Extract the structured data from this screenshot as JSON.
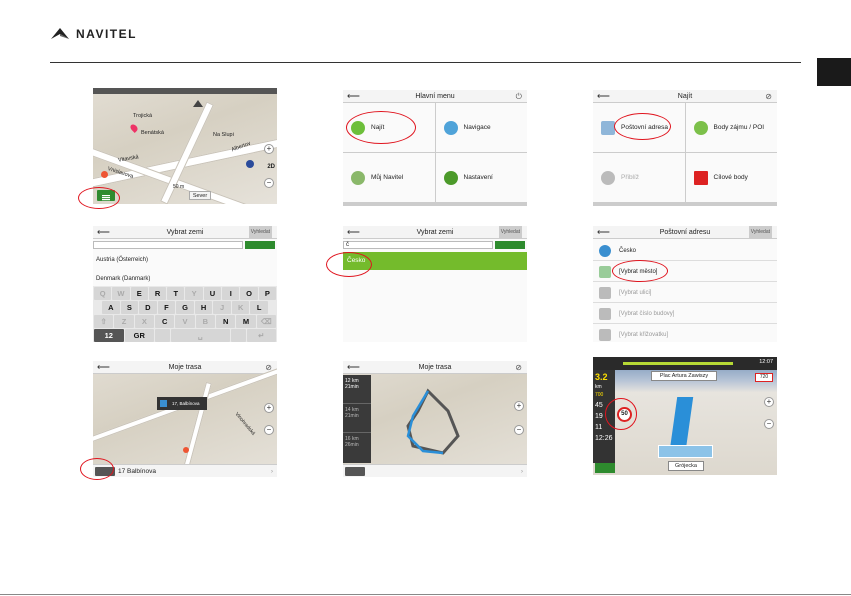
{
  "brand": {
    "name": "NAVITEL"
  },
  "screens": {
    "s1": {
      "street_names": [
        "Trojická",
        "Benátská",
        "Vltavská",
        "Albertov",
        "Na Slupi",
        "Vnislavova"
      ],
      "distance": "50 m",
      "direction": "Sever",
      "mode": "2D"
    },
    "s2": {
      "title": "Hlavní menu",
      "items": [
        "Najít",
        "Navigace",
        "Můj Navitel",
        "Nastavení"
      ]
    },
    "s3": {
      "title": "Najít",
      "items": [
        "Poštovní adresa",
        "Body zájmu / POI",
        "Přiblíž",
        "Cílové body"
      ]
    },
    "s4": {
      "title": "Vybrat zemi",
      "action": "Vyhledat",
      "list": [
        "Austria (Österreich)",
        "Denmark (Danmark)"
      ],
      "keys_row1": [
        "Q",
        "W",
        "E",
        "R",
        "T",
        "Y",
        "U",
        "I",
        "O",
        "P"
      ],
      "keys_row2": [
        "A",
        "S",
        "D",
        "F",
        "G",
        "H",
        "J",
        "K",
        "L"
      ],
      "keys_row3": [
        "Z",
        "X",
        "C",
        "V",
        "B",
        "N",
        "M"
      ],
      "key_12": "12",
      "key_gr": "GR"
    },
    "s5": {
      "title": "Vybrat zemi",
      "action": "Vyhledat",
      "input": "č",
      "selected": "Česko"
    },
    "s6": {
      "title": "Poštovní adresu",
      "action": "Vyhledat",
      "rows": [
        "Česko",
        "[Vybrat město]",
        "[Vybrat ulici]",
        "[Vybrat číslo budovy]",
        "[Vybrat křižovatku]"
      ]
    },
    "s7": {
      "title": "Moje trasa",
      "popup": "17, Balbínova",
      "street": "Vinohradská",
      "address": "17 Balbínova"
    },
    "s8": {
      "title": "Moje trasa",
      "routes": [
        {
          "dist": "12",
          "unit": "km",
          "time": "21min"
        },
        {
          "dist": "14",
          "unit": "km",
          "time": "21min"
        },
        {
          "dist": "16",
          "unit": "km",
          "time": "26min"
        }
      ]
    },
    "s9": {
      "street_top": "Plac Artura Zawiszy",
      "time": "12:07",
      "speed": "3.2",
      "speed_unit": "km",
      "turn_dist": "700",
      "remaining": "45",
      "limit": "50",
      "eta_1": "19",
      "eta_2": "11",
      "clock": "12:26",
      "street_bottom": "Grójecka",
      "limit_sign": "720"
    }
  }
}
